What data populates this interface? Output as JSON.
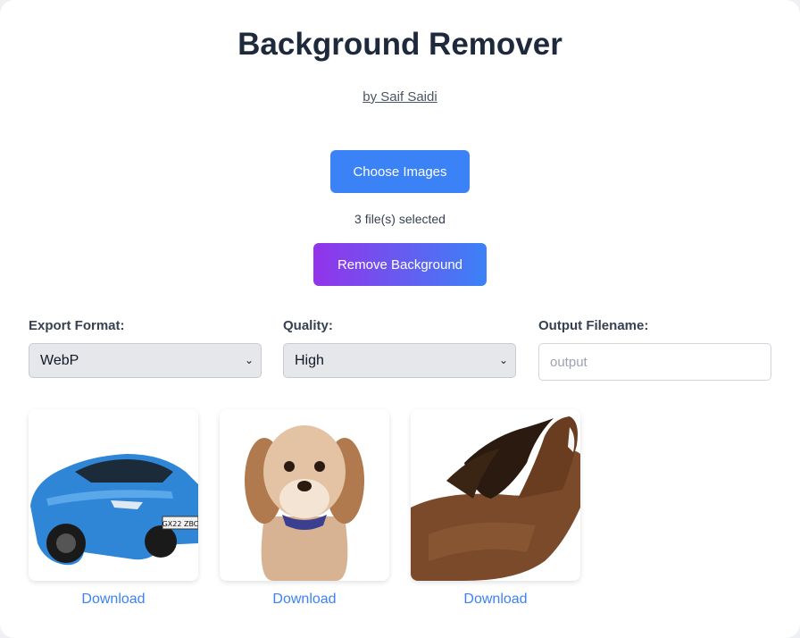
{
  "header": {
    "title": "Background Remover",
    "author": "by Saif Saidi"
  },
  "upload": {
    "choose_label": "Choose Images",
    "status": "3 file(s) selected",
    "remove_label": "Remove Background"
  },
  "settings": {
    "format_label": "Export Format:",
    "format_value": "WebP",
    "quality_label": "Quality:",
    "quality_value": "High",
    "filename_label": "Output Filename:",
    "filename_placeholder": "output"
  },
  "results": [
    {
      "subject": "car",
      "plate": "GX22 ZBC",
      "download_label": "Download"
    },
    {
      "subject": "dog",
      "download_label": "Download"
    },
    {
      "subject": "horse",
      "download_label": "Download"
    }
  ],
  "colors": {
    "primary": "#3b82f6",
    "gradient_start": "#9333ea",
    "gradient_end": "#3b82f6"
  }
}
